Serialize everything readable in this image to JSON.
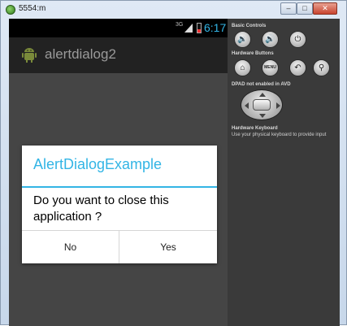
{
  "window": {
    "title": "5554:m",
    "min_label": "–",
    "max_label": "□",
    "close_label": "✕"
  },
  "status_bar": {
    "network": "3G",
    "time": "6:17"
  },
  "action_bar": {
    "title": "alertdialog2"
  },
  "dialog": {
    "title": "AlertDialogExample",
    "message": "Do you want to close this application ?",
    "negative_button": "No",
    "positive_button": "Yes"
  },
  "controls": {
    "basic_controls_label": "Basic Controls",
    "hardware_buttons_label": "Hardware Buttons",
    "dpad_label": "DPAD not enabled in AVD",
    "keyboard_label": "Hardware Keyboard",
    "keyboard_hint": "Use your physical keyboard to provide input",
    "menu_button": "MENU"
  },
  "icons": {
    "app": "emulator-icon",
    "launcher": "android-icon",
    "signal": "signal-icon",
    "battery": "battery-icon"
  },
  "colors": {
    "accent": "#33b5e5",
    "action_bar": "#222222",
    "screen_bg": "#454545"
  }
}
